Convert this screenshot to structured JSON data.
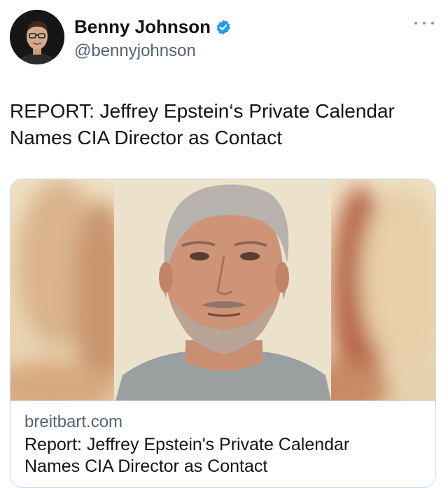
{
  "author": {
    "display_name": "Benny Johnson",
    "handle": "@bennyjohnson",
    "verified": true,
    "avatar_icon": "profile-photo"
  },
  "tweet": {
    "text": "REPORT: Jeffrey Epstein‘s Private Calendar\nNames CIA Director as Contact"
  },
  "link_card": {
    "image_icon": "portrait-photo",
    "domain": "breitbart.com",
    "title": "Report: Jeffrey Epstein's Private Calendar\nNames CIA Director as Contact"
  },
  "colors": {
    "verified_badge": "#1d9bf0",
    "secondary_text": "#536471",
    "border": "#cfd9de"
  },
  "icons": {
    "more": "more-horizontal-icon",
    "verified": "verified-badge-icon"
  }
}
